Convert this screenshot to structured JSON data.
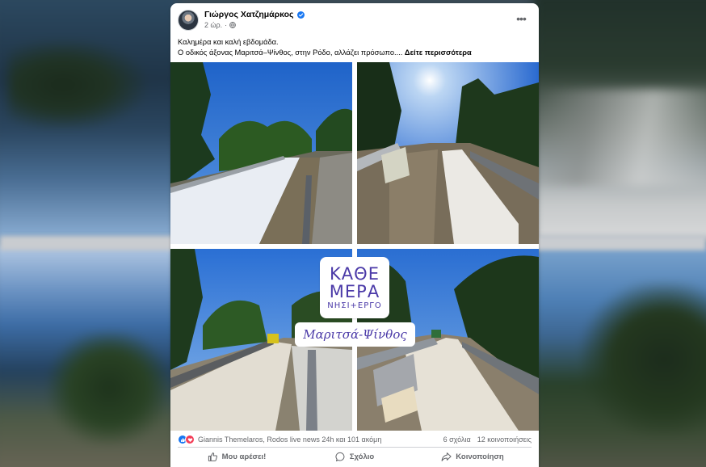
{
  "post": {
    "author": "Γιώργος Χατζημάρκος",
    "time": "2 ώρ.",
    "more_label": "•••",
    "caption_line1": "Καλημέρα και καλή εβδομάδα.",
    "caption_line2": "Ο οδικός άξονας Μαριτσά–Ψίνθος, στην Ρόδο, αλλάζει πρόσωπο....",
    "see_more": "Δείτε περισσότερα"
  },
  "overlay": {
    "line1": "ΚΑΘΕ",
    "line2": "ΜΕΡΑ",
    "line3": "ΝΗΣΙ+ΕΡΓΟ",
    "place": "Μαριτσά-Ψίνθος"
  },
  "stats": {
    "reactions_text": "Giannis Themelaros, Rodos live news 24h και 101 ακόμη",
    "comments": "6 σχόλια",
    "shares": "12 κοινοποιήσεις"
  },
  "actions": {
    "like": "Μου αρέσει!",
    "comment": "Σχόλιο",
    "share": "Κοινοποίηση"
  },
  "colors": {
    "brand_blue": "#1877f2",
    "love_red": "#f33e58",
    "overlay_purple": "#4b3aa8",
    "text_secondary": "#65676b"
  },
  "icons": [
    "verified-badge-icon",
    "globe-icon",
    "more-icon",
    "like-reaction-icon",
    "love-reaction-icon",
    "like-icon",
    "comment-icon",
    "share-icon"
  ]
}
